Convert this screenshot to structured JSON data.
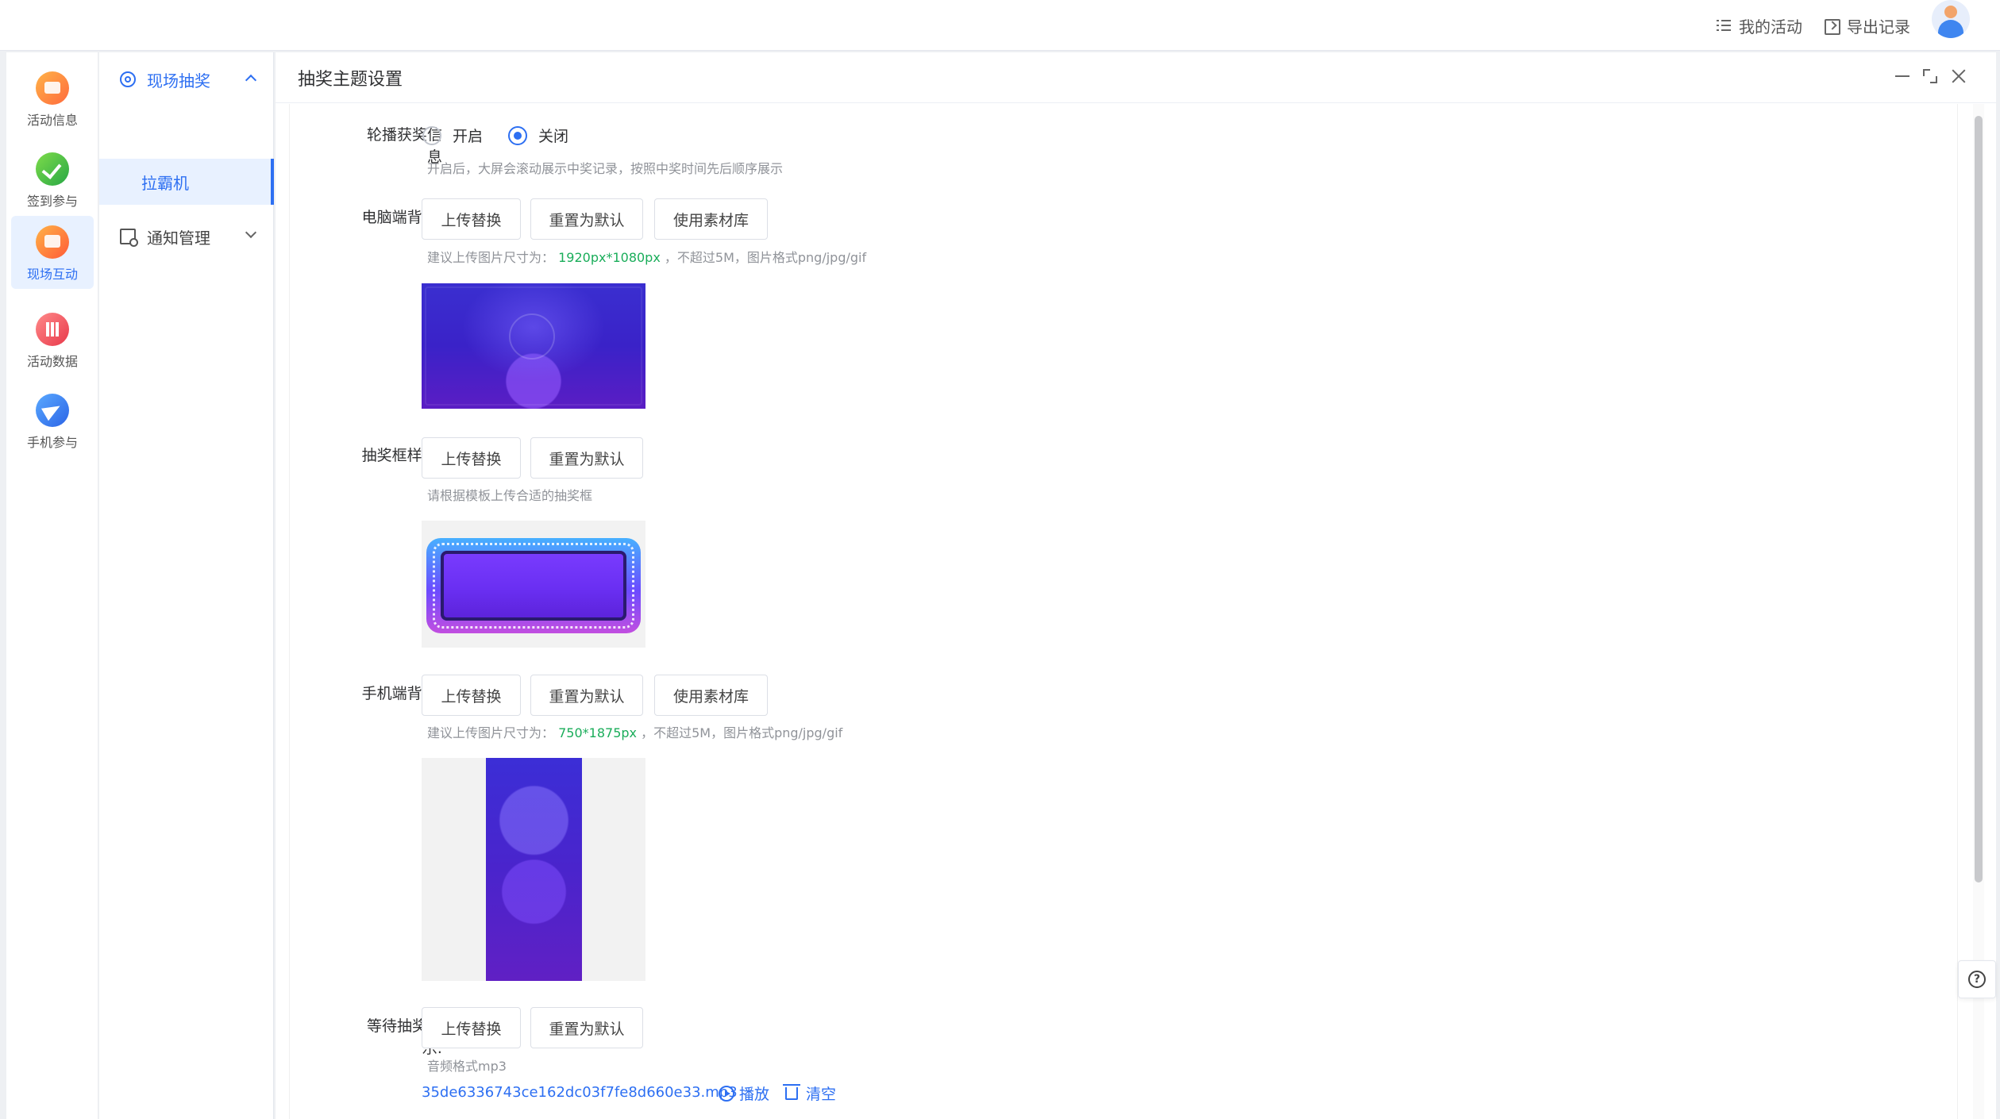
{
  "topbar": {
    "my_activity": "我的活动",
    "export_records": "导出记录"
  },
  "rail": {
    "items": [
      {
        "label": "活动信息",
        "icon": "activity-info-icon"
      },
      {
        "label": "签到参与",
        "icon": "checkin-icon"
      },
      {
        "label": "现场互动",
        "icon": "live-interaction-icon",
        "active": true
      },
      {
        "label": "活动数据",
        "icon": "activity-data-icon"
      },
      {
        "label": "手机参与",
        "icon": "mobile-participation-icon"
      }
    ]
  },
  "submenu": {
    "group1": "现场抽奖",
    "group1_item": "拉霸机",
    "group2": "通知管理"
  },
  "panel": {
    "title": "抽奖主题设置",
    "help": "?"
  },
  "form": {
    "carousel": {
      "label_line1": "轮播获奖信",
      "label_line2": "息",
      "option_on": "开启",
      "option_off": "关闭",
      "selected": "关闭",
      "tip": "开启后，大屏会滚动展示中奖记录，按照中奖时间先后顺序展示"
    },
    "pc_bg": {
      "label": "电脑端背景:",
      "btn_upload": "上传替换",
      "btn_reset": "重置为默认",
      "btn_library": "使用素材库",
      "tip_prefix": "建议上传图片尺寸为：",
      "tip_size": "1920px*1080px",
      "tip_suffix": "，不超过5M，图片格式png/jpg/gif"
    },
    "frame_style": {
      "label": "抽奖框样式:",
      "btn_upload": "上传替换",
      "btn_reset": "重置为默认",
      "tip": "请根据模板上传合适的抽奖框"
    },
    "mobile_bg": {
      "label": "手机端背景:",
      "btn_upload": "上传替换",
      "btn_reset": "重置为默认",
      "btn_library": "使用素材库",
      "tip_prefix": "建议上传图片尺寸为：",
      "tip_size": "750*1875px",
      "tip_suffix": "，不超过5M，图片格式png/jpg/gif"
    },
    "music": {
      "label_line1": "等待抽奖音",
      "label_line2": "乐:",
      "btn_upload": "上传替换",
      "btn_reset": "重置为默认",
      "tip": "音频格式mp3",
      "file_name": "35de6336743ce162dc03f7fe8d660e33.mp3",
      "play": "播放",
      "clear": "清空"
    }
  },
  "colors": {
    "accent": "#2d6ff2",
    "highlight": "#1aad5a"
  }
}
